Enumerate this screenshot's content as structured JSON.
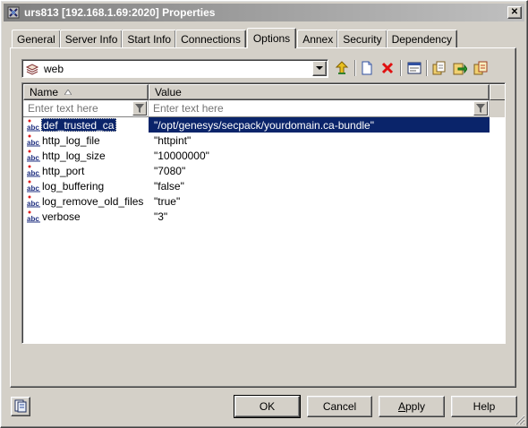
{
  "window": {
    "title": "urs813 [192.168.1.69:2020] Properties",
    "close_symbol": "✕"
  },
  "tabs": [
    {
      "label": "General",
      "active": false
    },
    {
      "label": "Server Info",
      "active": false
    },
    {
      "label": "Start Info",
      "active": false
    },
    {
      "label": "Connections",
      "active": false
    },
    {
      "label": "Options",
      "active": true
    },
    {
      "label": "Annex",
      "active": false
    },
    {
      "label": "Security",
      "active": false
    },
    {
      "label": "Dependency",
      "active": false
    }
  ],
  "options": {
    "section_selector": {
      "value": "web",
      "icon": "section-icon"
    },
    "toolbar": [
      {
        "name": "up-level-icon"
      },
      {
        "name": "new-icon"
      },
      {
        "name": "delete-icon"
      },
      {
        "name": "properties-icon"
      },
      {
        "name": "export-icon"
      },
      {
        "name": "import-icon"
      },
      {
        "name": "copy-icon"
      }
    ],
    "grid": {
      "columns": [
        {
          "label": "Name",
          "sorted": "ascending"
        },
        {
          "label": "Value"
        }
      ],
      "filter_placeholder": "Enter text here",
      "rows": [
        {
          "name": "def_trusted_ca",
          "value": "\"/opt/genesys/secpack/yourdomain.ca-bundle\"",
          "selected": true
        },
        {
          "name": "http_log_file",
          "value": "\"httpint\"",
          "selected": false
        },
        {
          "name": "http_log_size",
          "value": "\"10000000\"",
          "selected": false
        },
        {
          "name": "http_port",
          "value": "\"7080\"",
          "selected": false
        },
        {
          "name": "log_buffering",
          "value": "\"false\"",
          "selected": false
        },
        {
          "name": "log_remove_old_files",
          "value": "\"true\"",
          "selected": false
        },
        {
          "name": "verbose",
          "value": "\"3\"",
          "selected": false
        }
      ],
      "row_icon": "abc-string-icon"
    }
  },
  "buttons": {
    "ok": "OK",
    "cancel": "Cancel",
    "apply_prefix": "A",
    "apply_rest": "pply",
    "help": "Help"
  },
  "colors": {
    "selection": "#0a246a",
    "face": "#d4d0c8"
  }
}
